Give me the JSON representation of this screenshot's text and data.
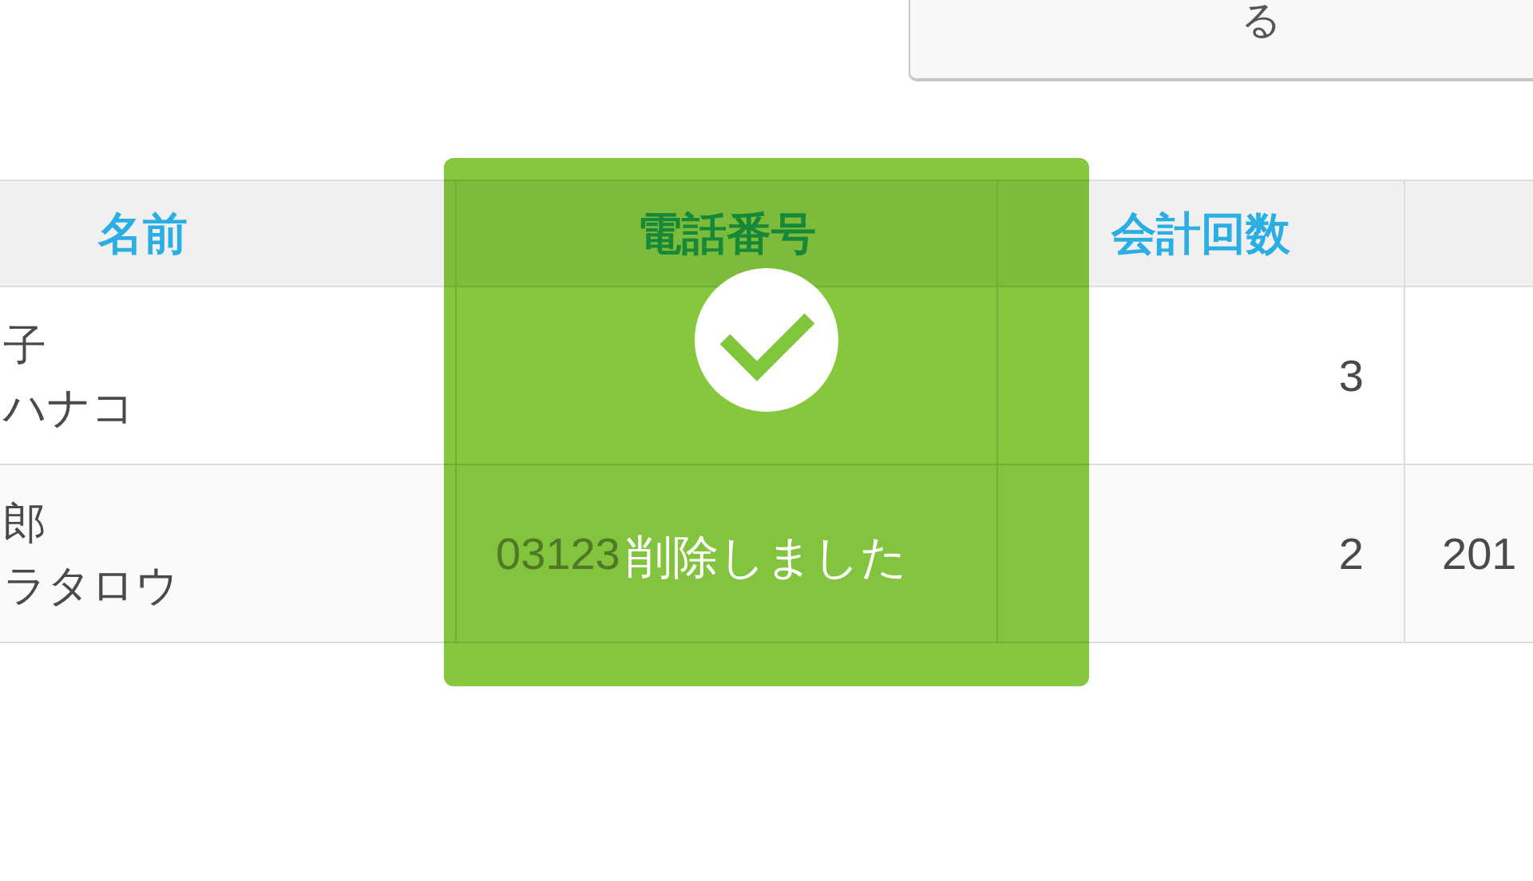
{
  "top_button": {
    "label": "る"
  },
  "table": {
    "columns": [
      "名前",
      "電話番号",
      "会計回数"
    ],
    "rows": [
      {
        "name": "子",
        "reading": "ハナコ",
        "visits": "3"
      },
      {
        "name": "郎",
        "reading": "ラタロウ",
        "phone": "03123",
        "visits": "2",
        "column_4": "201"
      }
    ]
  },
  "toast": {
    "message": "削除しました"
  }
}
